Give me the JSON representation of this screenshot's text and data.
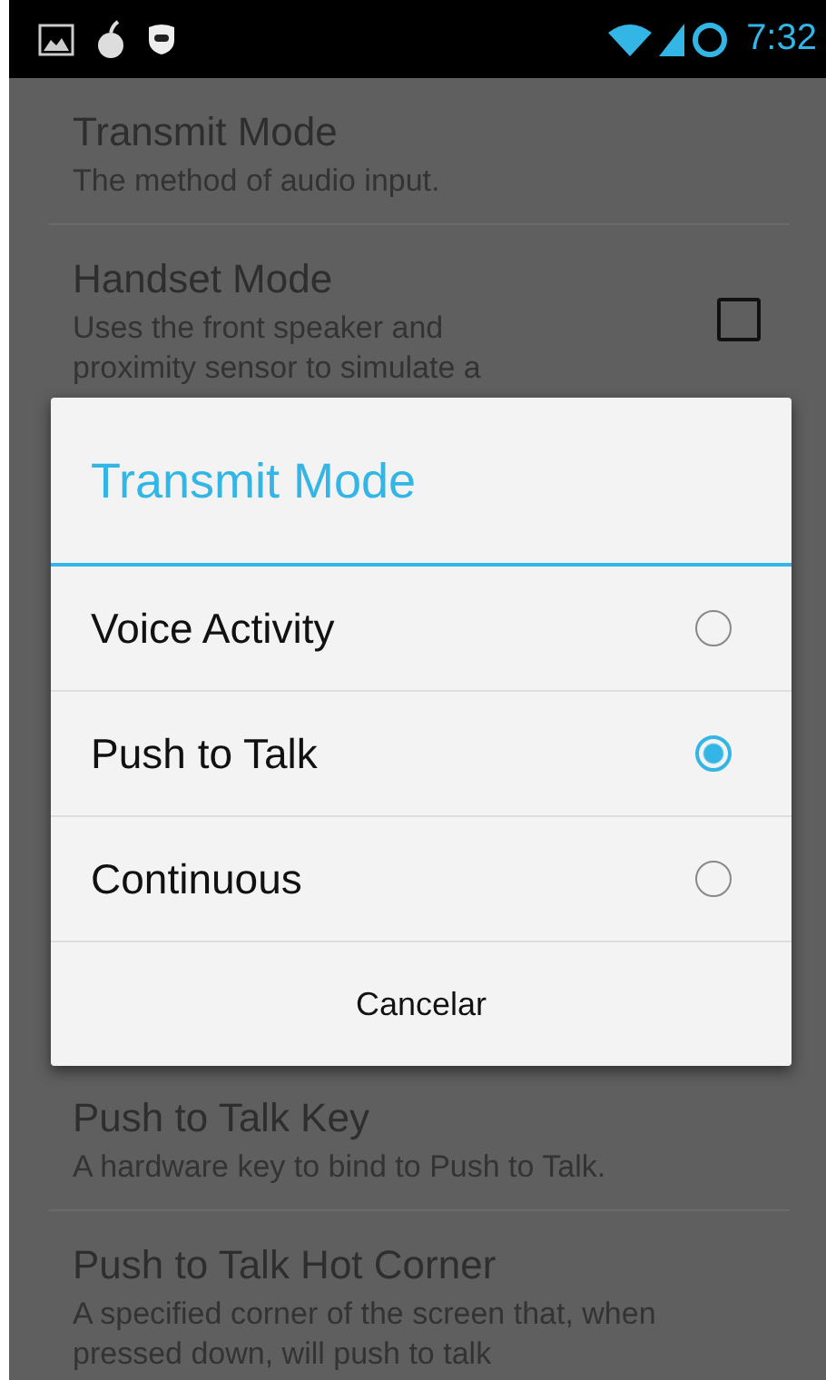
{
  "status_bar": {
    "time": "7:32"
  },
  "settings_top": [
    {
      "title": "Transmit Mode",
      "description": "The method of audio input."
    },
    {
      "title": "Handset Mode",
      "description": "Uses the front speaker and proximity sensor to simulate a",
      "kind": "checkbox",
      "checked": false
    }
  ],
  "dialog": {
    "title": "Transmit Mode",
    "options": [
      {
        "label": "Voice Activity",
        "selected": false
      },
      {
        "label": "Push to Talk",
        "selected": true
      },
      {
        "label": "Continuous",
        "selected": false
      }
    ],
    "button": "Cancelar"
  },
  "settings_bottom": [
    {
      "title": "Push to Talk Key",
      "description": "A hardware key to bind to Push to Talk."
    },
    {
      "title": "Push to Talk Hot Corner",
      "description": "A specified corner of the screen that, when pressed down, will push to talk"
    }
  ]
}
